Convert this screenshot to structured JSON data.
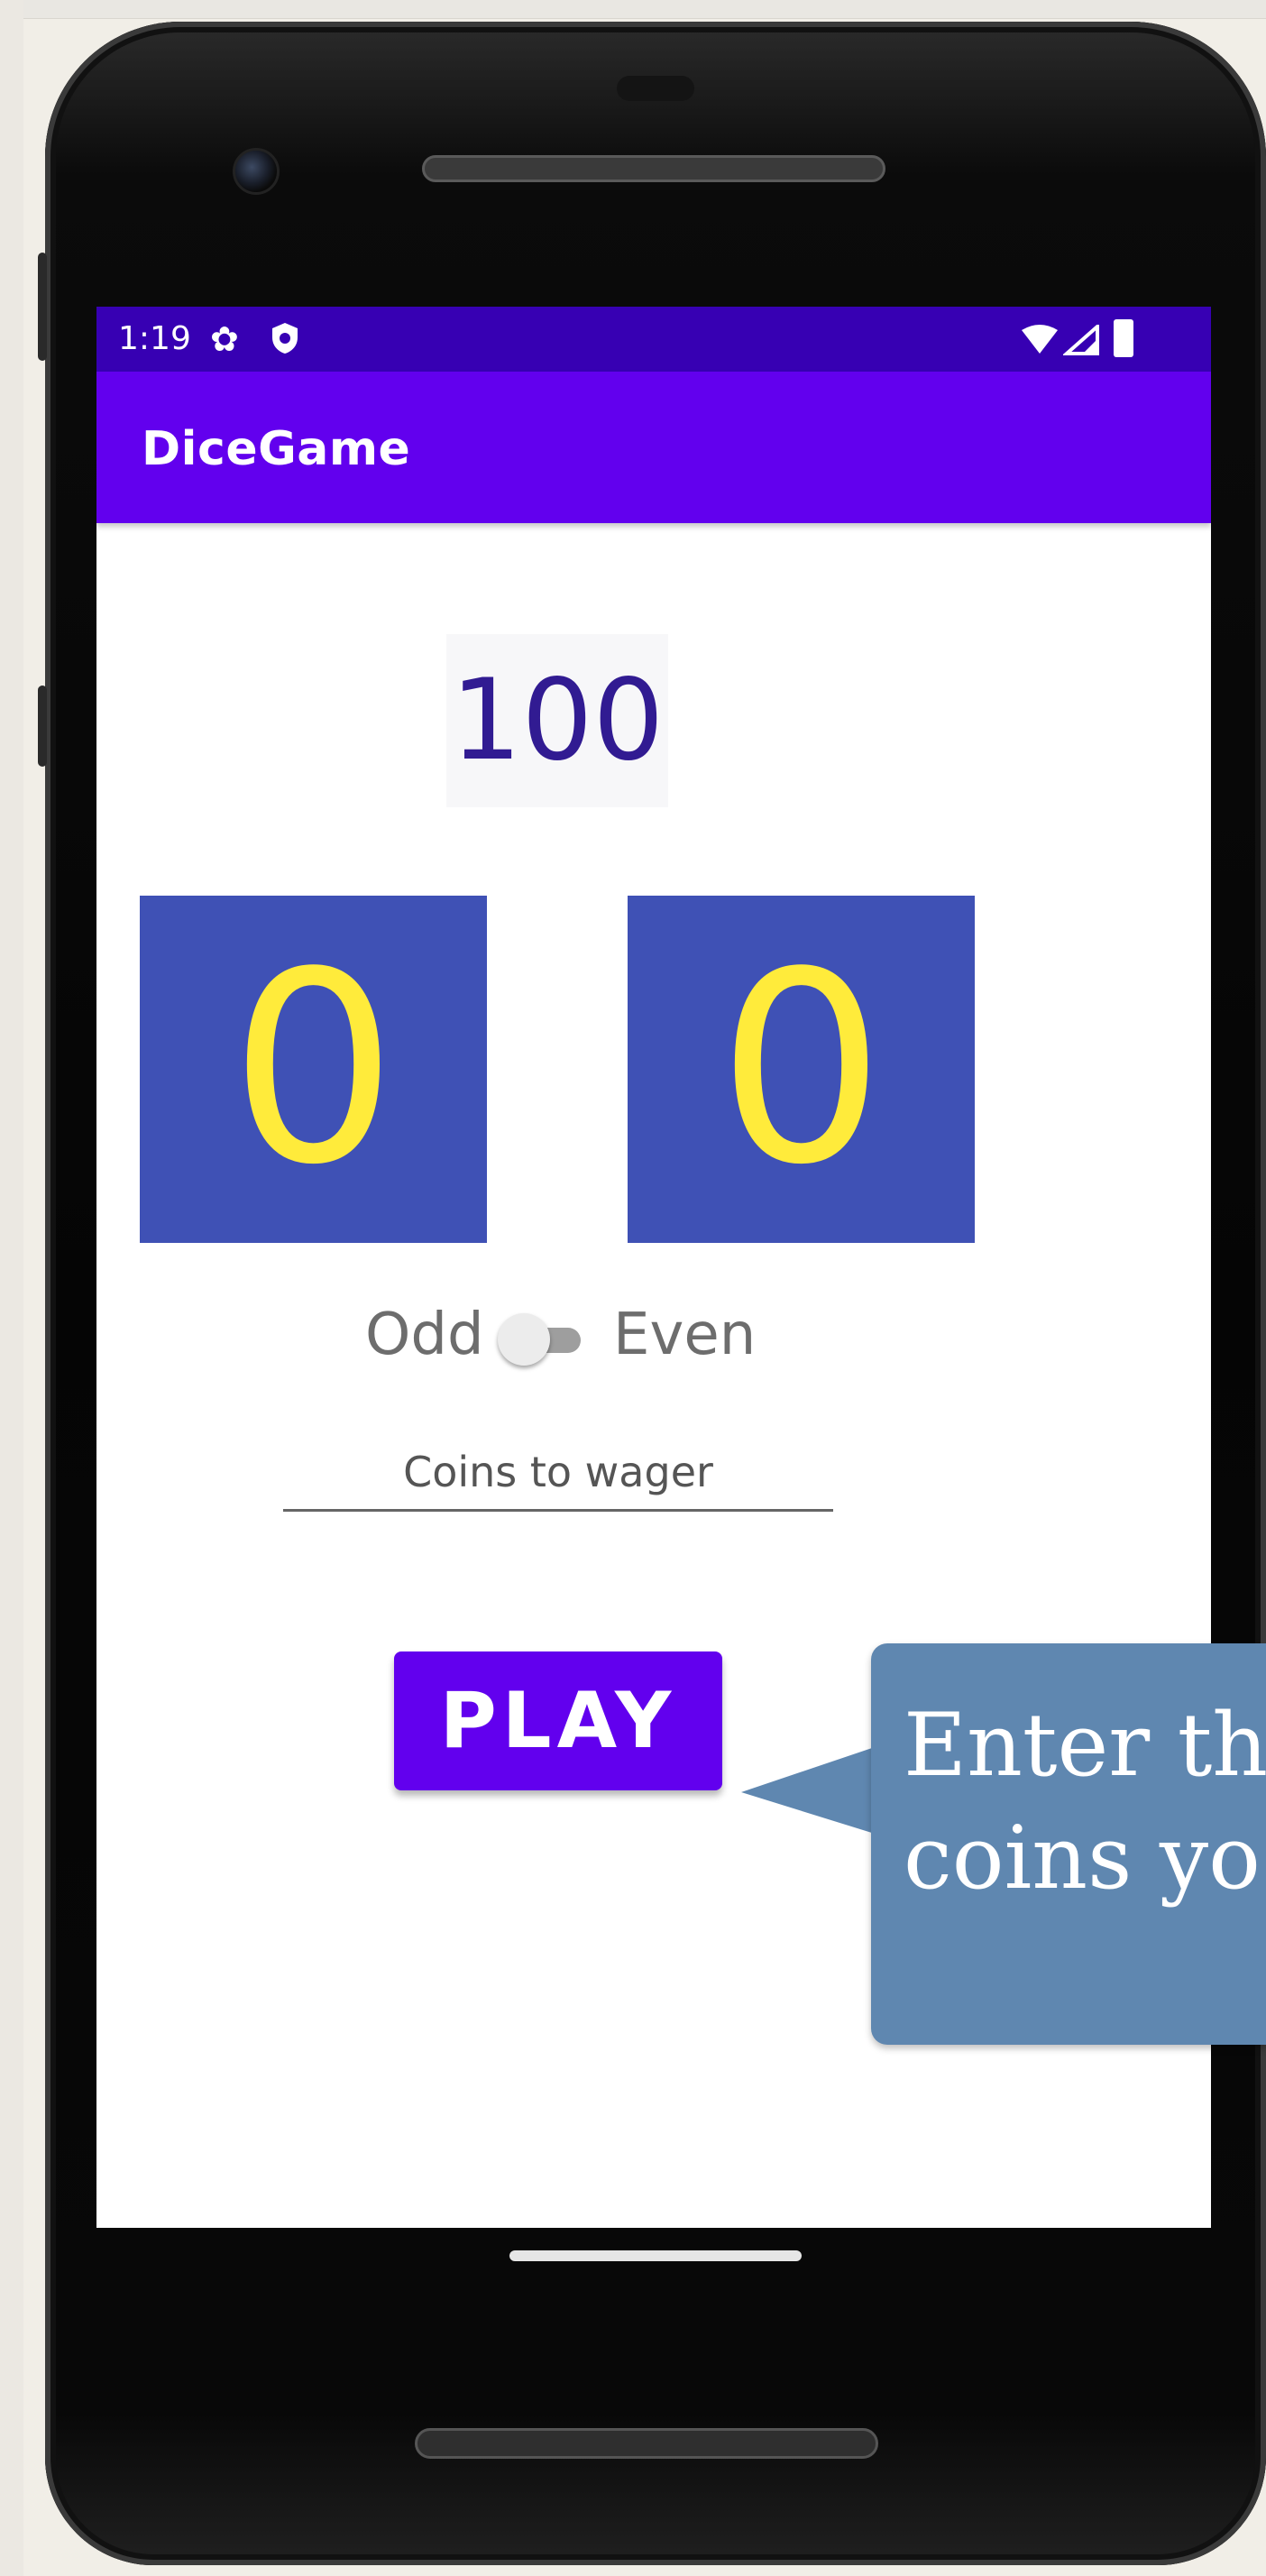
{
  "status_bar": {
    "time": "1:19",
    "icons": [
      "settings-icon",
      "shield-icon",
      "wifi-icon",
      "signal-icon",
      "battery-icon"
    ]
  },
  "app_bar": {
    "title": "DiceGame"
  },
  "game": {
    "coins": "100",
    "die_1": "0",
    "die_2": "0",
    "odd_label": "Odd",
    "even_label": "Even",
    "parity_switch_on": false,
    "wager_input": {
      "value": "",
      "placeholder": "Coins to wager"
    },
    "play_button": "PLAY"
  },
  "callout": {
    "line_1": "Enter th",
    "line_2": "coins yo"
  },
  "colors": {
    "status_bar": "#3700b3",
    "app_bar": "#6200ee",
    "die_background": "#3f51b5",
    "die_text": "#ffeb3b",
    "coins_text": "#311b92",
    "callout": "#5f87b0"
  }
}
